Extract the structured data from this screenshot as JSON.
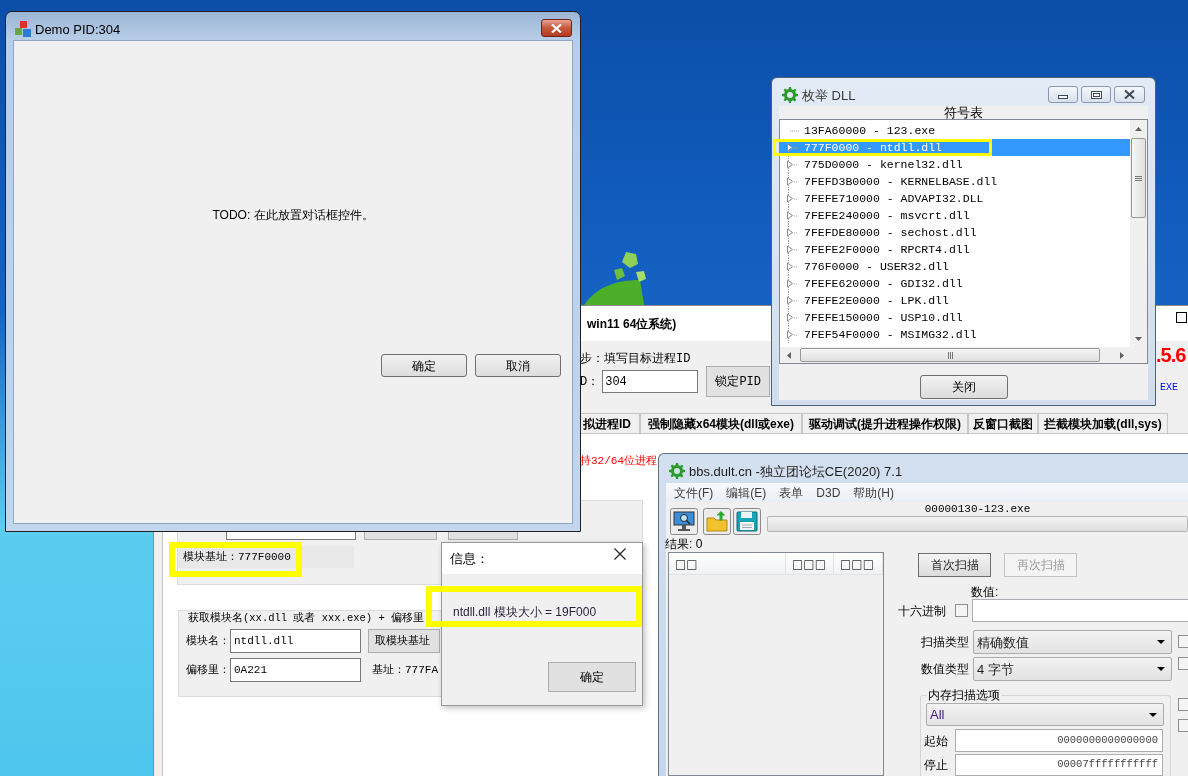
{
  "demo_window": {
    "title": "Demo PID:304",
    "message": "TODO: 在此放置对话框控件。",
    "buttons": [
      "确定",
      "取消"
    ]
  },
  "main_window": {
    "title": "win11 64位系统)",
    "step_label": "步：填写目标进程ID",
    "pid_label": "D：",
    "pid_value": "304",
    "lock_button": "锁定PID",
    "version_fragment": ".5.6",
    "link_fragment": "EXE",
    "tabs": [
      {
        "label": "拟进程ID",
        "selected": false
      },
      {
        "label": "强制隐藏x64模块(dll或exe)",
        "selected": false
      },
      {
        "label": "驱动调试(提升进程操作权限)",
        "selected": false
      },
      {
        "label": "反窗口截图",
        "selected": false
      },
      {
        "label": "拦截模块加载(dll,sys)",
        "selected": false
      }
    ],
    "red_note": "持32/64位进程",
    "base_address": "模块基址：777F0000",
    "offset_group": {
      "title": "获取模块名(xx.dll 或者 xxx.exe) + 偏移里",
      "module_label": "模块名：",
      "module_value": "ntdll.dll",
      "get_base_button": "取模块基址",
      "offset_label": "偏移里：",
      "offset_value": "0A221",
      "result": "基址：777FA"
    }
  },
  "dll_window": {
    "title": "枚举 DLL",
    "header": "符号表",
    "items": [
      {
        "text": "13FA60000 - 123.exe",
        "expandable": false,
        "selected": false
      },
      {
        "text": "777F0000 - ntdll.dll",
        "expandable": true,
        "selected": true
      },
      {
        "text": "775D0000 - kernel32.dll",
        "expandable": true,
        "selected": false
      },
      {
        "text": "7FEFD3B0000 - KERNELBASE.dll",
        "expandable": true,
        "selected": false
      },
      {
        "text": "7FEFE710000 - ADVAPI32.DLL",
        "expandable": true,
        "selected": false
      },
      {
        "text": "7FEFE240000 - msvcrt.dll",
        "expandable": true,
        "selected": false
      },
      {
        "text": "7FEFDE80000 - sechost.dll",
        "expandable": true,
        "selected": false
      },
      {
        "text": "7FEFE2F0000 - RPCRT4.dll",
        "expandable": true,
        "selected": false
      },
      {
        "text": "776F0000 - USER32.dll",
        "expandable": true,
        "selected": false
      },
      {
        "text": "7FEFE620000 - GDI32.dll",
        "expandable": true,
        "selected": false
      },
      {
        "text": "7FEFE2E0000 - LPK.dll",
        "expandable": true,
        "selected": false
      },
      {
        "text": "7FEFE150000 - USP10.dll",
        "expandable": true,
        "selected": false
      },
      {
        "text": "7FEF54F0000 - MSIMG32.dll",
        "expandable": true,
        "selected": false
      }
    ],
    "close_button": "关闭"
  },
  "info_dialog": {
    "title": "信息：",
    "message": "ntdll.dll 模块大小 = 19F000",
    "ok_button": "确定"
  },
  "ce_window": {
    "title": "bbs.dult.cn -独立团论坛CE(2020) 7.1",
    "menu": [
      "文件(F)",
      "编辑(E)",
      "表单",
      "D3D",
      "帮助(H)"
    ],
    "process": "00000130-123.exe",
    "scan_progress": {
      "level": 0
    },
    "results_label": "结果: 0",
    "columns": [
      "□□",
      "□□□",
      "□□□"
    ],
    "scan_buttons": [
      {
        "label": "首次扫描",
        "disabled": false
      },
      {
        "label": "再次扫描",
        "disabled": true
      }
    ],
    "value_label": "数值:",
    "hex": {
      "label": "十六进制",
      "checked": false
    },
    "scan_type": {
      "label": "扫描类型",
      "value": "精确数值"
    },
    "value_type": {
      "label": "数值类型",
      "value": "4 字节"
    },
    "memory_options": {
      "title": "内存扫描选项",
      "region": "All",
      "start_label": "起始",
      "start_value": "0000000000000000",
      "stop_label": "停止",
      "stop_value": "00007fffffffffff"
    },
    "side_checkboxes": [
      {
        "checked": false
      },
      {
        "checked": false
      },
      {
        "checked": false
      },
      {
        "checked": false
      }
    ]
  }
}
